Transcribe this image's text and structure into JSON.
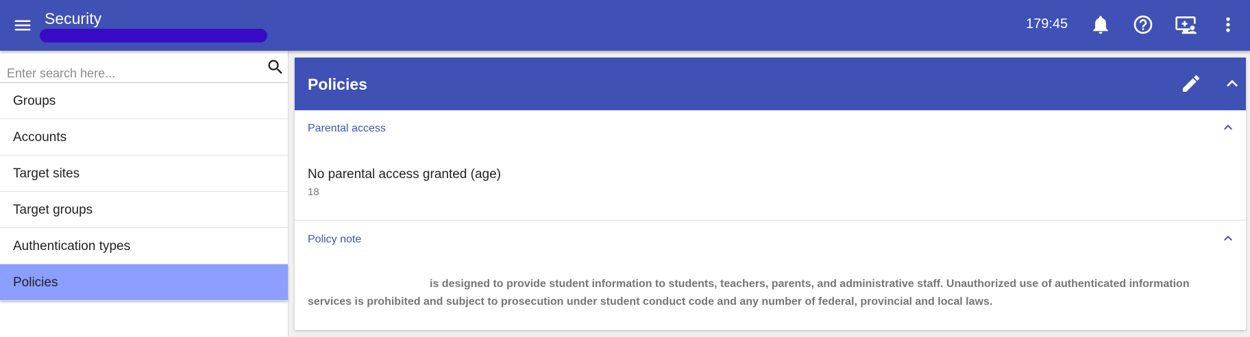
{
  "header": {
    "title": "Security",
    "timer": "179:45",
    "menu_icon": "menu-icon",
    "icons": [
      "bell-icon",
      "help-icon",
      "screen-share-icon",
      "more-vert-icon"
    ]
  },
  "sidebar": {
    "search_placeholder": "Enter search here...",
    "items": [
      {
        "label": "Groups"
      },
      {
        "label": "Accounts"
      },
      {
        "label": "Target sites"
      },
      {
        "label": "Target groups"
      },
      {
        "label": "Authentication types"
      },
      {
        "label": "Policies"
      }
    ],
    "active_index": 5
  },
  "card": {
    "title": "Policies",
    "sections": [
      {
        "title": "Parental access",
        "field_label": "No parental access granted (age)",
        "field_value": "18"
      },
      {
        "title": "Policy note",
        "text": "is designed to provide student information to students, teachers, parents, and administrative staff. Unauthorized use of authenticated information services is prohibited and subject to prosecution under student conduct code and any number of federal, provincial and local laws."
      }
    ]
  },
  "colors": {
    "primary": "#3f51b5",
    "active_nav": "#8c9eff",
    "redaction": "#3a0bc4"
  }
}
